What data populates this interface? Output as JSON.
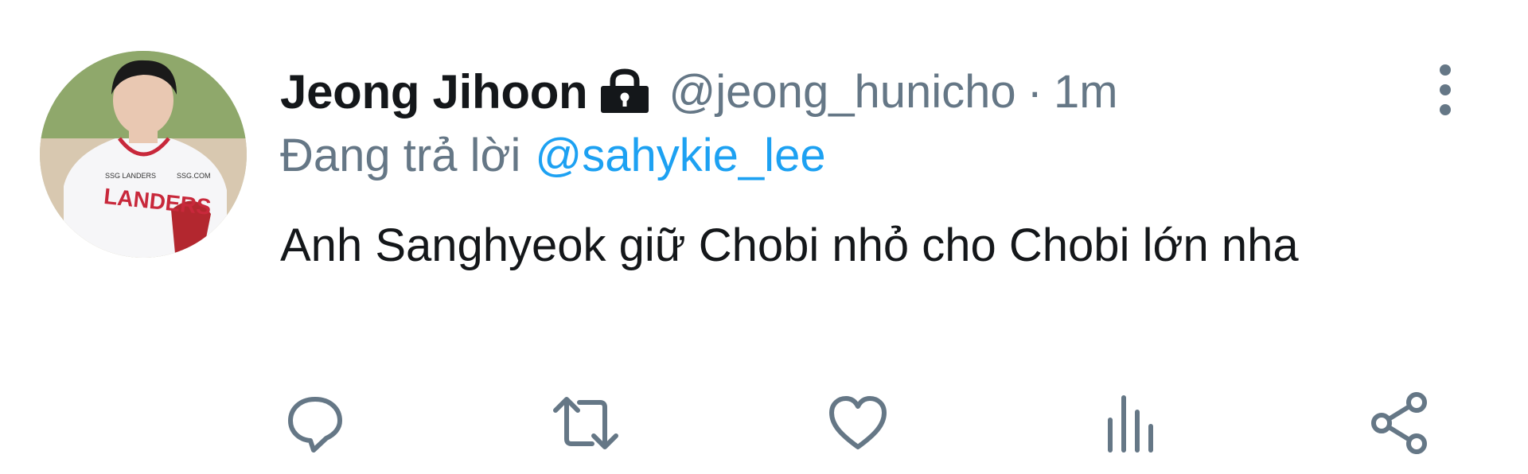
{
  "tweet": {
    "display_name": "Jeong Jihoon",
    "protected_icon": "lock-icon",
    "handle": "@jeong_hunicho",
    "separator": "·",
    "timestamp": "1m",
    "reply_prefix": "Đang trả lời",
    "reply_to": "@sahykie_lee",
    "text": "Anh Sanghyeok giữ Chobi nhỏ cho Chobi lớn nha",
    "avatar": {
      "jersey_text": "LANDERS",
      "jersey_small_left": "SSG LANDERS",
      "jersey_small_right": "SSG.COM"
    }
  },
  "actions": [
    {
      "name": "reply",
      "icon": "reply-icon"
    },
    {
      "name": "retweet",
      "icon": "retweet-icon"
    },
    {
      "name": "like",
      "icon": "heart-icon"
    },
    {
      "name": "analytics",
      "icon": "bar-chart-icon"
    },
    {
      "name": "share",
      "icon": "share-icon"
    }
  ],
  "menu_icon": "more-vertical-icon",
  "colors": {
    "text_primary": "#14171a",
    "text_secondary": "#657786",
    "link": "#1da1f2",
    "icon": "#657786"
  }
}
